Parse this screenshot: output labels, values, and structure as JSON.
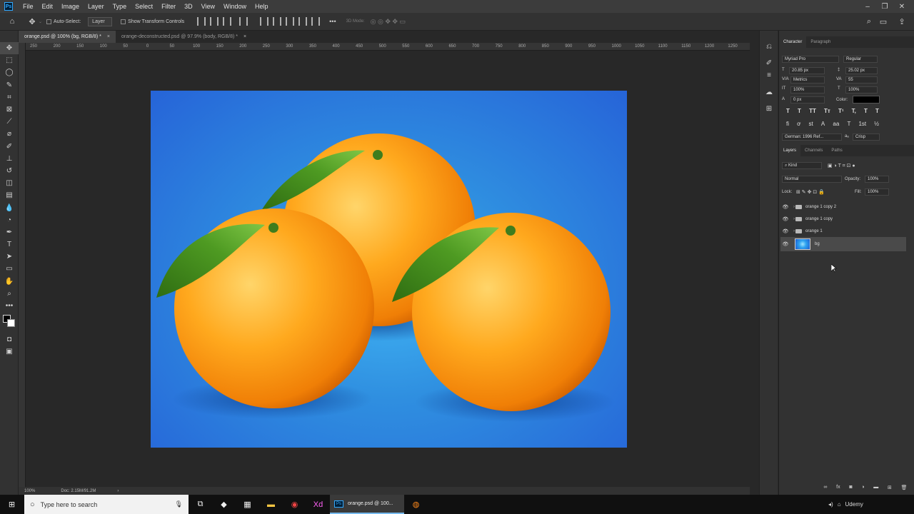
{
  "menubar": {
    "logo": "Ps",
    "items": [
      "File",
      "Edit",
      "Image",
      "Layer",
      "Type",
      "Select",
      "Filter",
      "3D",
      "View",
      "Window",
      "Help"
    ],
    "win_controls": [
      "minimize-icon",
      "restore-icon",
      "close-icon"
    ]
  },
  "options": {
    "auto_select": "Auto-Select:",
    "auto_select_value": "Layer",
    "show_transform": "Show Transform Controls",
    "mode_3d": "3D Mode:",
    "more": "•••"
  },
  "tabs": [
    {
      "label": "orange.psd @ 100% (bg, RGB/8) *",
      "active": true
    },
    {
      "label": "orange-deconstructed.psd @ 97.9% (body, RGB/8) *",
      "active": false
    }
  ],
  "ruler": {
    "h_labels": [
      "250",
      "200",
      "150",
      "100",
      "50",
      "0",
      "50",
      "100",
      "150",
      "200",
      "250",
      "300",
      "350",
      "400",
      "450",
      "500",
      "550",
      "600",
      "650",
      "700",
      "750",
      "800",
      "850",
      "900",
      "950",
      "1000",
      "1050",
      "1100",
      "1150",
      "1200",
      "1250"
    ]
  },
  "status": {
    "zoom": "100%",
    "doc": "Doc: 2.15M/91.2M",
    "arrow": "›"
  },
  "character": {
    "tabs": [
      "Character",
      "Paragraph"
    ],
    "font_family": "Myriad Pro",
    "font_style": "Regular",
    "font_size": "20.85 px",
    "leading": "25.02 px",
    "kerning": "Metrics",
    "tracking": "55",
    "vscale": "100%",
    "hscale": "100%",
    "baseline": "0 px",
    "color_label": "Color:",
    "color": "#000000",
    "style_buttons": [
      "T",
      "T",
      "TT",
      "Tт",
      "T¹",
      "T,",
      "T",
      "T"
    ],
    "ot_buttons": [
      "fi",
      "ơ",
      "st",
      "A",
      "aa",
      "T",
      "1st",
      "½"
    ],
    "language": "German: 1996 Ref...",
    "aa_icon": "aₐ",
    "antialias": "Crisp"
  },
  "layers": {
    "tabs": [
      "Layers",
      "Channels",
      "Paths"
    ],
    "filter_kind": "Kind",
    "blend_mode": "Normal",
    "opacity_label": "Opacity:",
    "opacity": "100%",
    "lock_label": "Lock:",
    "fill_label": "Fill:",
    "fill": "100%",
    "items": [
      {
        "name": "orange 1 copy 2",
        "type": "group"
      },
      {
        "name": "orange 1 copy",
        "type": "group"
      },
      {
        "name": "orange 1",
        "type": "group"
      },
      {
        "name": "bg",
        "type": "layer",
        "selected": true
      }
    ]
  },
  "taskbar": {
    "search_placeholder": "Type here to search",
    "active_app": "orange.psd @ 100...",
    "tray": "Udemy"
  }
}
